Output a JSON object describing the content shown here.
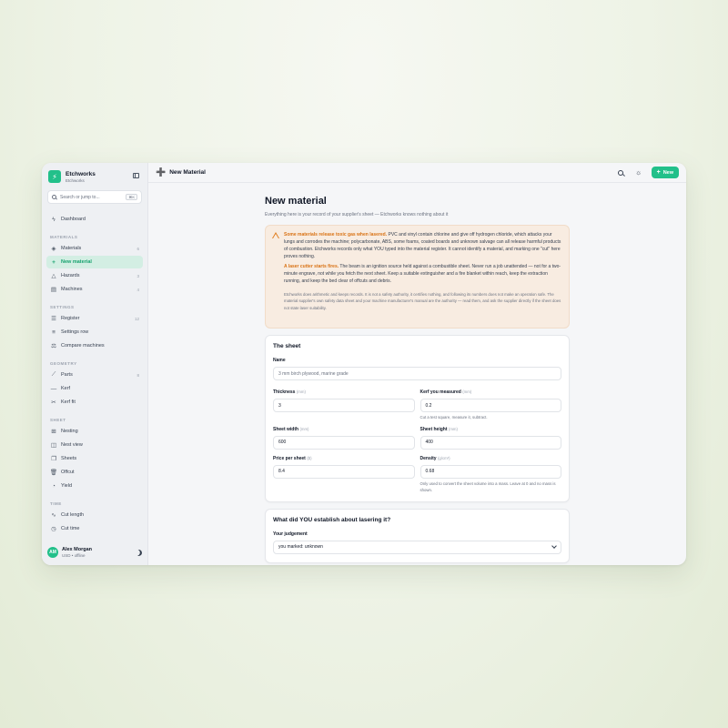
{
  "brand": {
    "name": "Etchworks",
    "sub": "Etchworks"
  },
  "search": {
    "placeholder": "Search or jump to...",
    "shortcut": "⌘K"
  },
  "sidebar": {
    "dashboard": "Dashboard",
    "sections": {
      "materials": "MATERIALS",
      "settings": "SETTINGS",
      "geometry": "GEOMETRY",
      "sheet": "SHEET",
      "time": "TIME"
    },
    "items": {
      "materials": {
        "label": "Materials",
        "count": "6"
      },
      "new_material": {
        "label": "New material"
      },
      "hazards": {
        "label": "Hazards",
        "count": "3"
      },
      "machines": {
        "label": "Machines",
        "count": "4"
      },
      "register": {
        "label": "Register",
        "count": "12"
      },
      "settings_row": {
        "label": "Settings row"
      },
      "compare_machines": {
        "label": "Compare machines"
      },
      "parts": {
        "label": "Parts",
        "count": "8"
      },
      "kerf": {
        "label": "Kerf"
      },
      "kerf_fit": {
        "label": "Kerf fit"
      },
      "nesting": {
        "label": "Nesting"
      },
      "nest_view": {
        "label": "Nest view"
      },
      "sheets": {
        "label": "Sheets"
      },
      "offcut": {
        "label": "Offcut"
      },
      "yield": {
        "label": "Yield"
      },
      "cut_length": {
        "label": "Cut length"
      },
      "cut_time": {
        "label": "Cut time"
      }
    }
  },
  "user": {
    "initials": "AM",
    "name": "Alex Morgan",
    "sub": "USD • offline"
  },
  "topbar": {
    "title": "New Material",
    "new_label": "New"
  },
  "page": {
    "title": "New material",
    "subtitle": "Everything here is your record of your supplier's sheet — Etchworks knows nothing about it"
  },
  "warning": {
    "p1_lead": "Some materials release toxic gas when lasered.",
    "p1_body": " PVC and vinyl contain chlorine and give off hydrogen chloride, which attacks your lungs and corrodes the machine; polycarbonate, ABS, some foams, coated boards and unknown salvage can all release harmful products of combustion. Etchworks records only what YOU typed into the material register. It cannot identify a material, and marking one \"cut\" here proves nothing.",
    "p2_lead": "A laser cutter starts fires.",
    "p2_body": " The beam is an ignition source held against a combustible sheet. Never run a job unattended — not for a two-minute engrave, not while you fetch the next sheet. Keep a suitable extinguisher and a fire blanket within reach, keep the extraction running, and keep the bed clear of offcuts and debris.",
    "fine": "Etchworks does arithmetic and keeps records. It is not a safety authority, it certifies nothing, and following its numbers does not make an operation safe. The material supplier's own safety data sheet and your machine manufacturer's manual are the authority — read them, and ask the supplier directly if the sheet does not state laser suitability."
  },
  "sheet_card": {
    "title": "The sheet",
    "name_label": "Name",
    "name_placeholder": "3 mm birch plywood, marine grade",
    "thickness_label": "Thickness",
    "thickness_unit": "(mm)",
    "thickness_value": "3",
    "kerf_label": "Kerf you measured",
    "kerf_unit": "(mm)",
    "kerf_value": "0.2",
    "kerf_help": "Cut a test square, measure it, subtract.",
    "width_label": "Sheet width",
    "width_unit": "(mm)",
    "width_value": "600",
    "height_label": "Sheet height",
    "height_unit": "(mm)",
    "height_value": "400",
    "price_label": "Price per sheet",
    "price_unit": "($)",
    "price_value": "8.4",
    "density_label": "Density",
    "density_unit": "(g/cm³)",
    "density_value": "0.68",
    "density_help": "Only used to convert the sheet volume into a mass. Leave at 0 and no mass is shown."
  },
  "judgement_card": {
    "title": "What did YOU establish about lasering it?",
    "label": "Your judgement",
    "value": "you marked: unknown"
  },
  "colors": {
    "accent": "#22c08a",
    "warning": "#d97214"
  }
}
